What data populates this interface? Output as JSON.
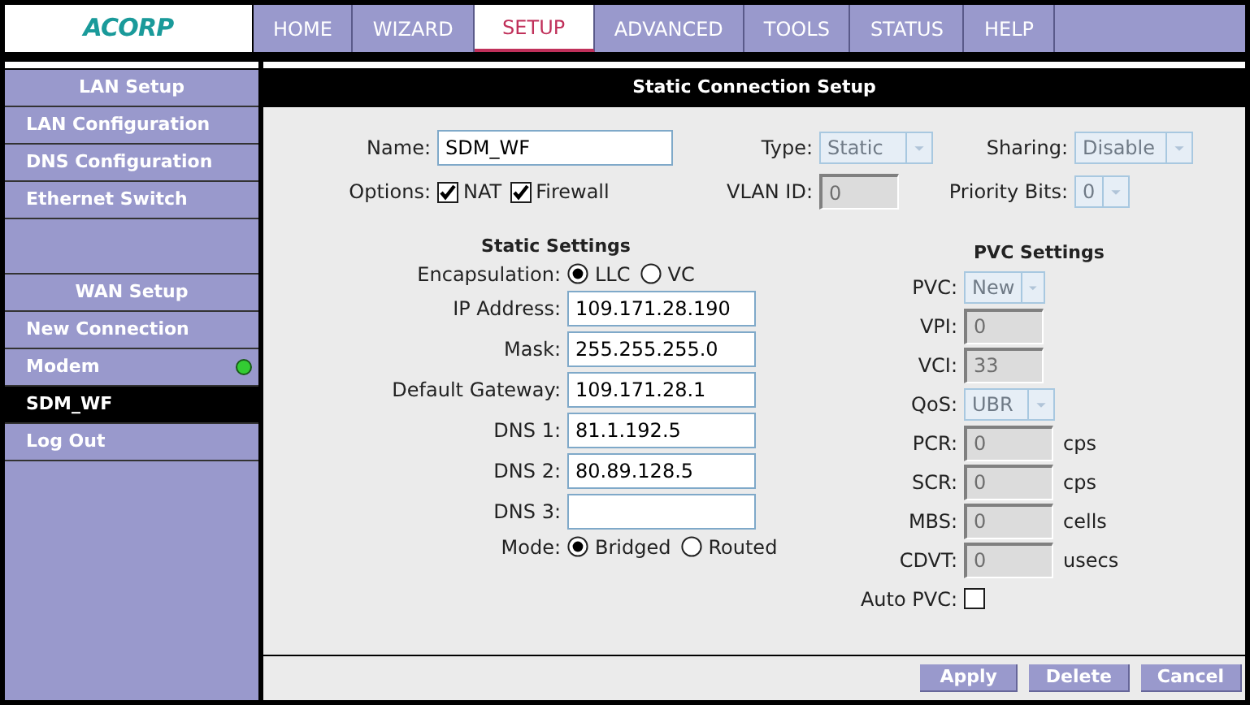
{
  "logo": {
    "text": "ACORP"
  },
  "nav": [
    {
      "label": "HOME",
      "selected": false
    },
    {
      "label": "WIZARD",
      "selected": false
    },
    {
      "label": "SETUP",
      "selected": true
    },
    {
      "label": "ADVANCED",
      "selected": false
    },
    {
      "label": "TOOLS",
      "selected": false
    },
    {
      "label": "STATUS",
      "selected": false
    },
    {
      "label": "HELP",
      "selected": false
    }
  ],
  "sidebar": [
    {
      "title": "LAN Setup",
      "items": [
        {
          "label": "LAN Configuration",
          "selected": false
        },
        {
          "label": "DNS Configuration",
          "selected": false
        },
        {
          "label": "Ethernet Switch",
          "selected": false
        }
      ]
    },
    {
      "title": "WAN Setup",
      "items": [
        {
          "label": "New Connection",
          "selected": false
        },
        {
          "label": "Modem",
          "selected": false,
          "color": "#33cc33"
        },
        {
          "label": "SDM_WF",
          "selected": true
        },
        {
          "label": "Log Out",
          "selected": false
        }
      ]
    }
  ],
  "panel": {
    "title": "Static Connection Setup",
    "name": {
      "label": "Name:",
      "value": "SDM_WF"
    },
    "type": {
      "label": "Type:",
      "value": "Static",
      "disabled": true
    },
    "sharing": {
      "label": "Sharing:",
      "value": "Disable",
      "disabled": true
    },
    "options": {
      "label": "Options:",
      "items": [
        {
          "label": "NAT",
          "checked": true
        },
        {
          "label": "Firewall",
          "checked": true
        }
      ]
    },
    "vlan_id": {
      "label": "VLAN ID:",
      "value": "0",
      "disabled": true
    },
    "priority_bits": {
      "label": "Priority Bits:",
      "value": "0",
      "disabled": true
    },
    "static_settings": {
      "title": "Static Settings",
      "encapsulation": {
        "label": "Encapsulation:",
        "options": [
          {
            "label": "LLC",
            "selected": true
          },
          {
            "label": "VC",
            "selected": false
          }
        ]
      },
      "fields": [
        {
          "label": "IP Address:",
          "value": "109.171.28.190"
        },
        {
          "label": "Mask:",
          "value": "255.255.255.0"
        },
        {
          "label": "Default Gateway:",
          "value": "109.171.28.1"
        },
        {
          "label": "DNS 1:",
          "value": "81.1.192.5"
        },
        {
          "label": "DNS 2:",
          "value": "80.89.128.5"
        },
        {
          "label": "DNS 3:"
        }
      ],
      "mode": {
        "label": "Mode:",
        "options": [
          {
            "label": "Bridged",
            "selected": true
          },
          {
            "label": "Routed",
            "selected": false
          }
        ]
      }
    },
    "pvc_settings": {
      "title": "PVC Settings",
      "rows": [
        {
          "kind": "select",
          "label": "PVC:",
          "value": "New",
          "disabled": true
        },
        {
          "kind": "input",
          "label": "VPI:",
          "value": "0",
          "disabled": true
        },
        {
          "kind": "input",
          "label": "VCI:",
          "value": "33",
          "disabled": true
        },
        {
          "kind": "select",
          "label": "QoS:",
          "value": "UBR",
          "disabled": true
        },
        {
          "kind": "input",
          "label": "PCR:",
          "value": "0",
          "unit": "cps",
          "disabled": true
        },
        {
          "kind": "input",
          "label": "SCR:",
          "value": "0",
          "unit": "cps",
          "disabled": true
        },
        {
          "kind": "input",
          "label": "MBS:",
          "value": "0",
          "unit": "cells",
          "disabled": true
        },
        {
          "kind": "input",
          "label": "CDVT:",
          "value": "0",
          "unit": "usecs",
          "disabled": true
        },
        {
          "kind": "checkbox",
          "label": "Auto PVC:",
          "checked": false
        }
      ]
    },
    "buttons": [
      "Apply",
      "Delete",
      "Cancel"
    ]
  }
}
